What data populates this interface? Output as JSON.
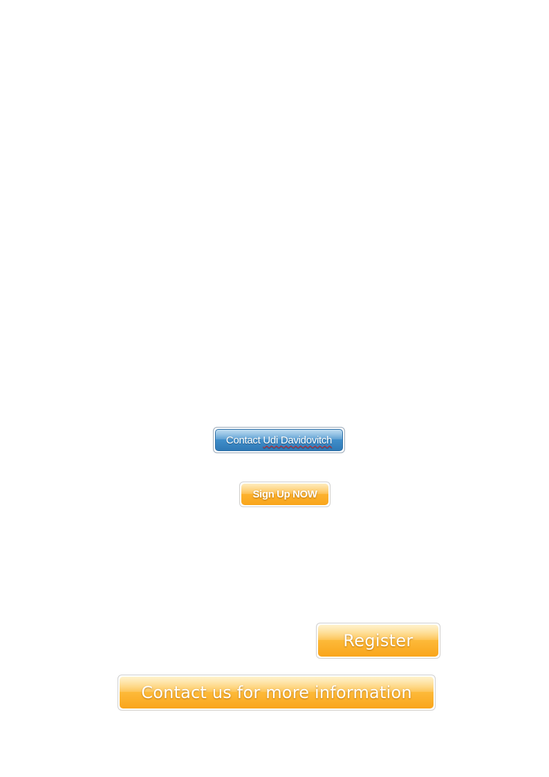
{
  "buttons": {
    "contact_udi": {
      "label_prefix": "Contact ",
      "label_name": "Udi Davidovitch",
      "color": "#3f8dc9"
    },
    "sign_up": {
      "label": "Sign Up NOW",
      "color": "#fdb22e"
    },
    "register": {
      "label": "Register",
      "color": "#fdb22e"
    },
    "contact_more": {
      "label": "Contact us for more information",
      "color": "#fdb22e"
    }
  }
}
